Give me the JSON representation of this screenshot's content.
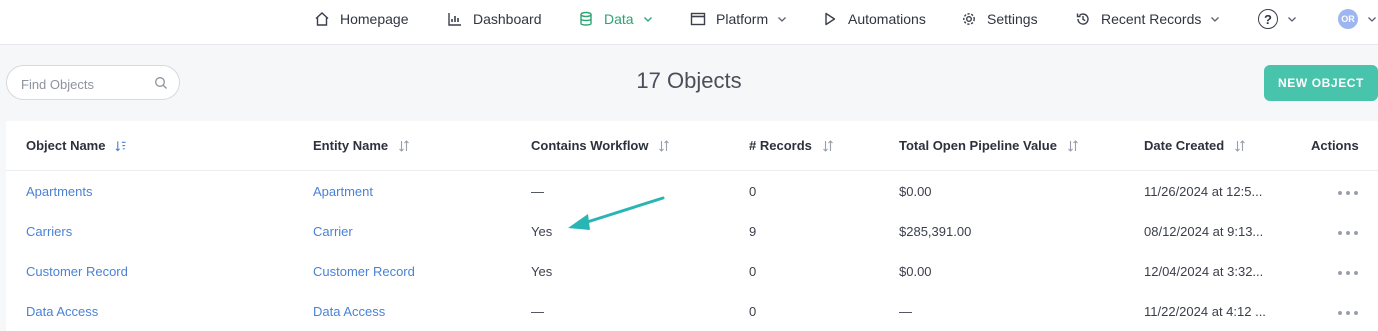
{
  "nav": {
    "items": [
      {
        "label": "Homepage",
        "icon": "home-icon"
      },
      {
        "label": "Dashboard",
        "icon": "chart-icon"
      },
      {
        "label": "Data",
        "icon": "database-icon",
        "active": true,
        "has_dropdown": true
      },
      {
        "label": "Platform",
        "icon": "window-icon",
        "has_dropdown": true
      },
      {
        "label": "Automations",
        "icon": "play-icon"
      },
      {
        "label": "Settings",
        "icon": "gear-icon"
      },
      {
        "label": "Recent Records",
        "icon": "history-icon",
        "has_dropdown": true
      }
    ],
    "help_symbol": "?",
    "avatar_initials": "OR",
    "active_color": "#2aa472"
  },
  "toolbar": {
    "search_placeholder": "Find Objects",
    "title": "17 Objects",
    "new_button_label": "NEW OBJECT",
    "accent": "#48c4ac"
  },
  "table": {
    "columns": [
      {
        "label": "Object Name",
        "sort": "active"
      },
      {
        "label": "Entity Name",
        "sort": "none"
      },
      {
        "label": "Contains Workflow",
        "sort": "none"
      },
      {
        "label": "# Records",
        "sort": "none"
      },
      {
        "label": "Total Open Pipeline Value",
        "sort": "none"
      },
      {
        "label": "Date Created",
        "sort": "none"
      },
      {
        "label": "Actions"
      }
    ],
    "rows": [
      {
        "object": "Apartments",
        "entity": "Apartment",
        "workflow": "—",
        "records": "0",
        "pipeline": "$0.00",
        "created": "11/26/2024 at 12:5..."
      },
      {
        "object": "Carriers",
        "entity": "Carrier",
        "workflow": "Yes",
        "records": "9",
        "pipeline": "$285,391.00",
        "created": "08/12/2024 at 9:13..."
      },
      {
        "object": "Customer Record",
        "entity": "Customer Record",
        "workflow": "Yes",
        "records": "0",
        "pipeline": "$0.00",
        "created": "12/04/2024 at 3:32..."
      },
      {
        "object": "Data Access",
        "entity": "Data Access",
        "workflow": "—",
        "records": "0",
        "pipeline": "—",
        "created": "11/22/2024 at 4:12 ..."
      }
    ],
    "link_color": "#4a82d6"
  },
  "annotation": {
    "type": "arrow",
    "color": "#2ab5b5",
    "points_to": "Carriers contains workflow"
  }
}
